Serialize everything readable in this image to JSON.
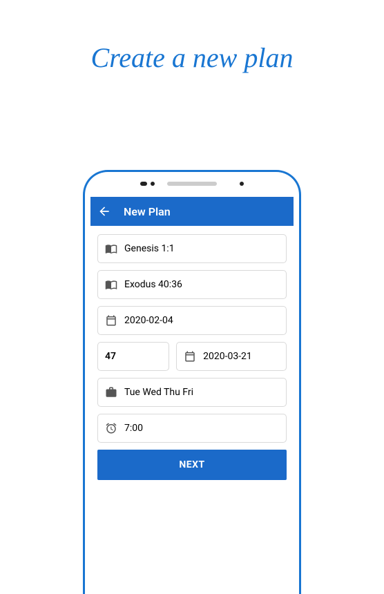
{
  "page_heading": "Create a new plan",
  "app_bar": {
    "title": "New Plan"
  },
  "fields": {
    "start_verse": "Genesis 1:1",
    "end_verse": "Exodus 40:36",
    "start_date": "2020-02-04",
    "duration_days": "47",
    "end_date": "2020-03-21",
    "days_of_week": "Tue Wed Thu Fri",
    "reminder_time": "7:00"
  },
  "next_button": "NEXT"
}
